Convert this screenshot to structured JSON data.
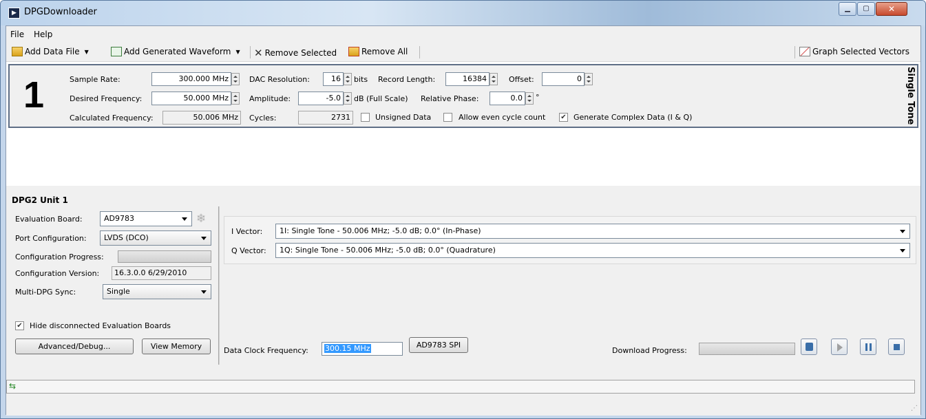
{
  "window": {
    "title": "DPGDownloader"
  },
  "menu": {
    "file": "File",
    "help": "Help"
  },
  "toolbar": {
    "add_data_file": "Add Data File",
    "add_generated_waveform": "Add Generated Waveform",
    "remove_selected": "Remove Selected",
    "remove_all": "Remove All",
    "graph_selected_vectors": "Graph Selected Vectors"
  },
  "waveform": {
    "index": "1",
    "type_label": "Single Tone",
    "sample_rate_label": "Sample Rate:",
    "sample_rate_value": "300.000 MHz",
    "desired_freq_label": "Desired Frequency:",
    "desired_freq_value": "50.000 MHz",
    "calc_freq_label": "Calculated Frequency:",
    "calc_freq_value": "50.006 MHz",
    "dac_res_label": "DAC Resolution:",
    "dac_res_value": "16",
    "dac_res_unit": "bits",
    "record_len_label": "Record Length:",
    "record_len_value": "16384",
    "offset_label": "Offset:",
    "offset_value": "0",
    "amplitude_label": "Amplitude:",
    "amplitude_value": "-5.0",
    "amplitude_unit": "dB (Full Scale)",
    "rel_phase_label": "Relative Phase:",
    "rel_phase_value": "0.0",
    "rel_phase_unit": "°",
    "cycles_label": "Cycles:",
    "cycles_value": "2731",
    "unsigned_label": "Unsigned Data",
    "unsigned_checked": false,
    "even_cycle_label": "Allow even cycle count",
    "even_cycle_checked": false,
    "complex_label": "Generate Complex Data (I & Q)",
    "complex_checked": true
  },
  "unit": {
    "title": "DPG2 Unit 1",
    "eval_board_label": "Evaluation Board:",
    "eval_board_value": "AD9783",
    "port_config_label": "Port Configuration:",
    "port_config_value": "LVDS (DCO)",
    "config_progress_label": "Configuration Progress:",
    "config_version_label": "Configuration Version:",
    "config_version_value": "16.3.0.0 6/29/2010",
    "multi_sync_label": "Multi-DPG Sync:",
    "multi_sync_value": "Single",
    "hide_disconnected_label": "Hide disconnected Evaluation Boards",
    "hide_disconnected_checked": true,
    "advanced_button": "Advanced/Debug...",
    "view_memory_button": "View Memory"
  },
  "vectors": {
    "i_label": "I Vector:",
    "i_value": "1I: Single Tone - 50.006 MHz; -5.0 dB; 0.0° (In-Phase)",
    "q_label": "Q Vector:",
    "q_value": "1Q: Single Tone - 50.006 MHz; -5.0 dB; 0.0° (Quadrature)"
  },
  "download": {
    "data_clock_label": "Data Clock Frequency:",
    "data_clock_value": "300.15 MHz",
    "spi_button": "AD9783 SPI",
    "progress_label": "Download Progress:"
  }
}
